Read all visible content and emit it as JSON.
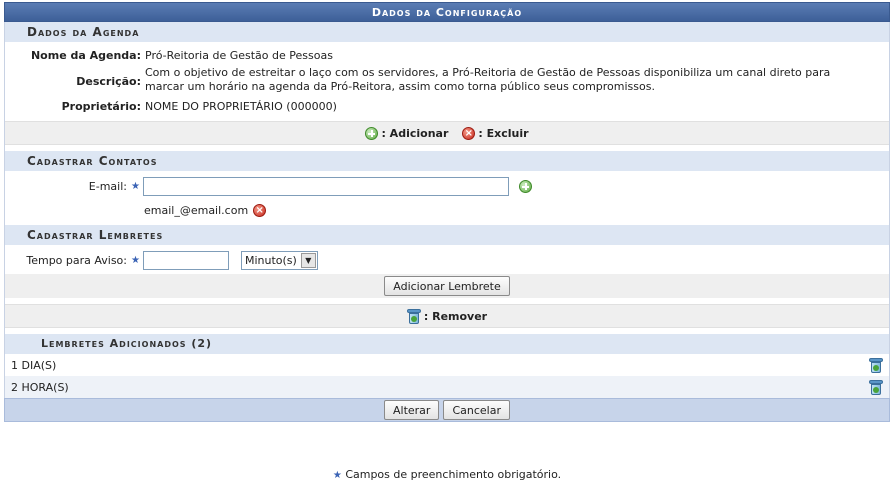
{
  "title": "Dados da Configuração",
  "agenda": {
    "heading": "Dados da Agenda",
    "nome_label": "Nome da Agenda:",
    "nome_value": "Pró-Reitoria de Gestão de Pessoas",
    "descricao_label": "Descrição:",
    "descricao_value": "Com o objetivo de estreitar o laço com os servidores, a Pró-Reitoria de Gestão de Pessoas disponibiliza um canal direto para marcar um horário na agenda da Pró-Reitora, assim como torna público seus compromissos.",
    "proprietario_label": "Proprietário:",
    "proprietario_value": "NOME DO PROPRIETÁRIO (000000)"
  },
  "legend1": {
    "add_label": ": Adicionar",
    "delete_label": ": Excluir"
  },
  "contatos": {
    "heading": "Cadastrar Contatos",
    "email_label": "E-mail:",
    "email_value": "",
    "added_email": "email_@email.com"
  },
  "lembretes": {
    "heading": "Cadastrar Lembretes",
    "tempo_label": "Tempo para Aviso:",
    "tempo_value": "",
    "unit_selected": "Minuto(s)",
    "add_button": "Adicionar Lembrete"
  },
  "legend2": {
    "remove_label": ": Remover"
  },
  "adicionados": {
    "heading": "Lembretes Adicionados (2)",
    "items": [
      "1 DIA(S)",
      "2 HORA(S)"
    ]
  },
  "actions": {
    "alterar": "Alterar",
    "cancelar": "Cancelar"
  },
  "note": "Campos de preenchimento obrigatório.",
  "required_mark": "★"
}
